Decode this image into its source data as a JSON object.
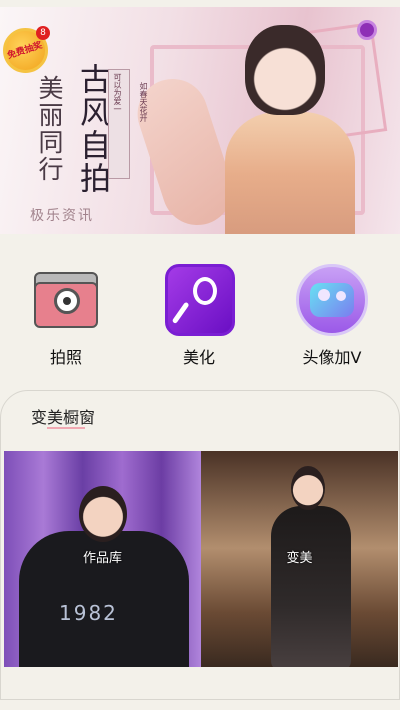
{
  "banner": {
    "badge_text": "免费抽奖",
    "badge_count": "8",
    "title_main": "古风自拍",
    "title_sub": "美丽同行",
    "tagline_1": "可以为爱一",
    "tagline_2": "如春天花开",
    "watermark": "极乐资讯"
  },
  "menu": [
    {
      "label": "拍照",
      "icon": "camera-icon"
    },
    {
      "label": "美化",
      "icon": "mirror-icon"
    },
    {
      "label": "头像加V",
      "icon": "avatar-v-icon"
    }
  ],
  "window": {
    "title": "变美橱窗",
    "cards": [
      {
        "label": "作品库",
        "photo_text": "1982"
      },
      {
        "label": "变美"
      }
    ]
  }
}
